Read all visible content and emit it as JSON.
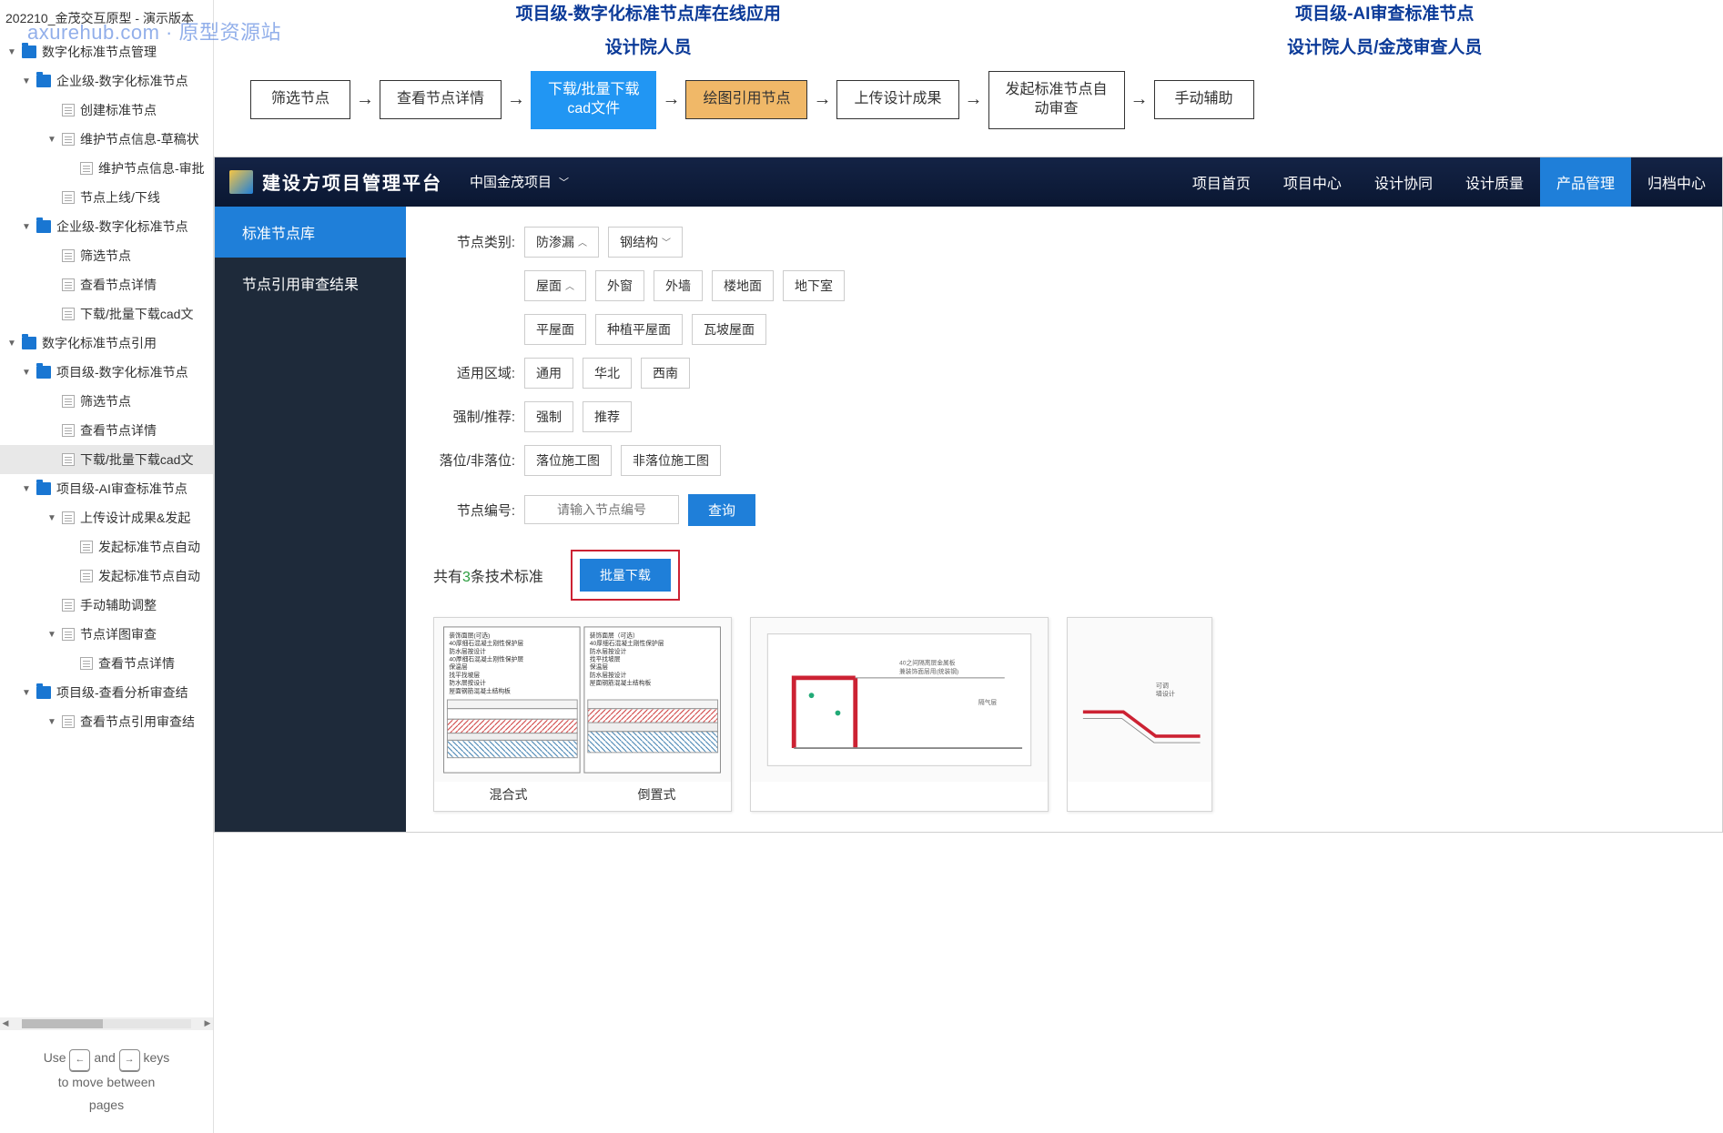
{
  "app_title": "202210_金茂交互原型 - 演示版本",
  "watermark": "axurehub.com · 原型资源站",
  "sidebar_tree": [
    {
      "level": 1,
      "caret": "▼",
      "icon": "folder",
      "label": "数字化标准节点管理"
    },
    {
      "level": 2,
      "caret": "▼",
      "icon": "folder",
      "label": "企业级-数字化标准节点"
    },
    {
      "level": 3,
      "caret": "",
      "icon": "page",
      "label": "创建标准节点"
    },
    {
      "level": 3,
      "caret": "▼",
      "icon": "page",
      "label": "维护节点信息-草稿状"
    },
    {
      "level": 4,
      "caret": "",
      "icon": "page",
      "label": "维护节点信息-审批"
    },
    {
      "level": 3,
      "caret": "",
      "icon": "page",
      "label": "节点上线/下线"
    },
    {
      "level": 2,
      "caret": "▼",
      "icon": "folder",
      "label": "企业级-数字化标准节点"
    },
    {
      "level": 3,
      "caret": "",
      "icon": "page",
      "label": "筛选节点"
    },
    {
      "level": 3,
      "caret": "",
      "icon": "page",
      "label": "查看节点详情"
    },
    {
      "level": 3,
      "caret": "",
      "icon": "page",
      "label": "下载/批量下载cad文"
    },
    {
      "level": 1,
      "caret": "▼",
      "icon": "folder",
      "label": "数字化标准节点引用"
    },
    {
      "level": 2,
      "caret": "▼",
      "icon": "folder",
      "label": "项目级-数字化标准节点"
    },
    {
      "level": 3,
      "caret": "",
      "icon": "page",
      "label": "筛选节点"
    },
    {
      "level": 3,
      "caret": "",
      "icon": "page",
      "label": "查看节点详情"
    },
    {
      "level": 3,
      "caret": "",
      "icon": "page",
      "label": "下载/批量下载cad文",
      "active": true
    },
    {
      "level": 2,
      "caret": "▼",
      "icon": "folder",
      "label": "项目级-AI审查标准节点"
    },
    {
      "level": 3,
      "caret": "▼",
      "icon": "page",
      "label": "上传设计成果&发起"
    },
    {
      "level": 4,
      "caret": "",
      "icon": "page",
      "label": "发起标准节点自动"
    },
    {
      "level": 4,
      "caret": "",
      "icon": "page",
      "label": "发起标准节点自动"
    },
    {
      "level": 3,
      "caret": "",
      "icon": "page",
      "label": "手动辅助调整"
    },
    {
      "level": 3,
      "caret": "▼",
      "icon": "page",
      "label": "节点详图审查"
    },
    {
      "level": 4,
      "caret": "",
      "icon": "page",
      "label": "查看节点详情"
    },
    {
      "level": 2,
      "caret": "▼",
      "icon": "folder",
      "label": "项目级-查看分析审查结"
    },
    {
      "level": 3,
      "caret": "▼",
      "icon": "page",
      "label": "查看节点引用审查结"
    }
  ],
  "kbd_hint": {
    "use": "Use",
    "and": "and",
    "keys": "keys",
    "move": "to move between",
    "pages": "pages",
    "left": "←",
    "right": "→"
  },
  "flow": {
    "left_title": "项目级-数字化标准节点库在线应用",
    "left_sub": "设计院人员",
    "right_title": "项目级-AI审查标准节点",
    "right_sub": "设计院人员/金茂审查人员",
    "boxes": [
      "筛选节点",
      "查看节点详情",
      "下载/批量下载\ncad文件",
      "绘图引用节点",
      "上传设计成果",
      "发起标准节点自\n动审查",
      "手动辅助"
    ]
  },
  "platform": {
    "title": "建设方项目管理平台",
    "project": "中国金茂项目",
    "nav": [
      "项目首页",
      "项目中心",
      "设计协同",
      "设计质量",
      "产品管理",
      "归档中心"
    ],
    "nav_active": 4,
    "side": [
      "标准节点库",
      "节点引用审查结果"
    ],
    "side_active": 0,
    "filters": {
      "category_label": "节点类别:",
      "category_tags": [
        {
          "t": "防渗漏",
          "c": "up"
        },
        {
          "t": "钢结构",
          "c": "down"
        }
      ],
      "category_sub1": [
        {
          "t": "屋面",
          "c": "up"
        },
        {
          "t": "外窗"
        },
        {
          "t": "外墙"
        },
        {
          "t": "楼地面"
        },
        {
          "t": "地下室"
        }
      ],
      "category_sub2": [
        {
          "t": "平屋面"
        },
        {
          "t": "种植平屋面"
        },
        {
          "t": "瓦坡屋面"
        }
      ],
      "region_label": "适用区域:",
      "region_tags": [
        {
          "t": "通用"
        },
        {
          "t": "华北"
        },
        {
          "t": "西南"
        }
      ],
      "force_label": "强制/推荐:",
      "force_tags": [
        {
          "t": "强制"
        },
        {
          "t": "推荐"
        }
      ],
      "place_label": "落位/非落位:",
      "place_tags": [
        {
          "t": "落位施工图"
        },
        {
          "t": "非落位施工图"
        }
      ],
      "code_label": "节点编号:",
      "code_placeholder": "请输入节点编号",
      "search_btn": "查询"
    },
    "results": {
      "prefix": "共有",
      "count": "3",
      "suffix": "条技术标准",
      "bulk_btn": "批量下载",
      "card1_captions": [
        "混合式",
        "倒置式"
      ]
    }
  }
}
